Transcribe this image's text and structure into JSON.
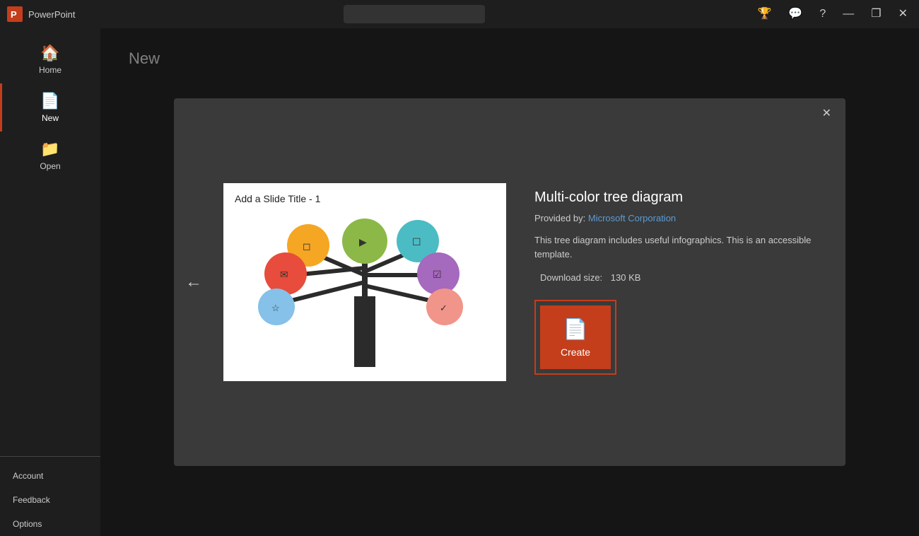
{
  "titleBar": {
    "appName": "PowerPoint",
    "searchPlaceholder": "",
    "buttons": {
      "minimize": "—",
      "maximize": "❐",
      "close": "✕"
    }
  },
  "sidebar": {
    "items": [
      {
        "id": "home",
        "label": "Home",
        "icon": "🏠",
        "active": false
      },
      {
        "id": "new",
        "label": "New",
        "icon": "📄",
        "active": true
      },
      {
        "id": "open",
        "label": "Open",
        "icon": "📁",
        "active": false
      }
    ],
    "bottomItems": [
      {
        "id": "account",
        "label": "Account"
      },
      {
        "id": "feedback",
        "label": "Feedback"
      },
      {
        "id": "options",
        "label": "Options"
      }
    ]
  },
  "content": {
    "pageTitle": "New"
  },
  "modal": {
    "title": "Multi-color tree diagram",
    "providedByLabel": "Provided by:",
    "providedByName": "Microsoft Corporation",
    "description": "This tree diagram includes useful infographics. This is an accessible template.",
    "downloadSizeLabel": "Download size:",
    "downloadSizeValue": "130 KB",
    "previewSlideTitle": "Add a Slide Title - 1",
    "createLabel": "Create",
    "backArrow": "←",
    "closeButton": "✕"
  }
}
